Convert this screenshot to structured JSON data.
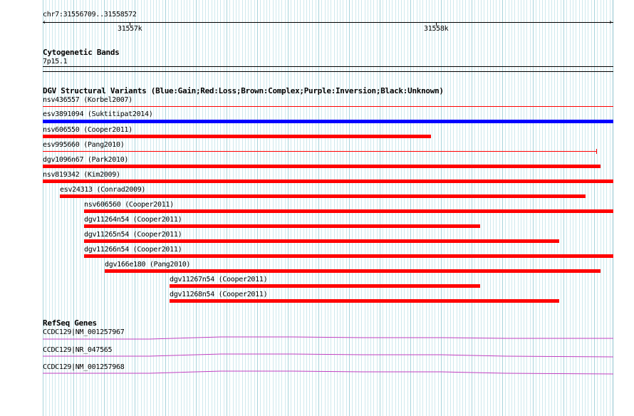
{
  "ruler": {
    "range_label": "chr7:31556709..31558572",
    "tick_labels": [
      "31557k",
      "31558k"
    ]
  },
  "cytobands": {
    "title": "Cytogenetic Bands",
    "band": "7p15.1"
  },
  "dgv": {
    "title": "DGV Structural Variants (Blue:Gain;Red:Loss;Brown:Complex;Purple:Inversion;Black:Unknown)",
    "colors": {
      "gain": "#0000ff",
      "loss": "#ff0000"
    },
    "variants": [
      {
        "label": "nsv436557 (Korbel2007)",
        "type": "loss"
      },
      {
        "label": "esv3891094 (Suktitipat2014)",
        "type": "gain"
      },
      {
        "label": "nsv606550 (Cooper2011)",
        "type": "loss"
      },
      {
        "label": "esv995660 (Pang2010)",
        "type": "loss"
      },
      {
        "label": "dgv1096n67 (Park2010)",
        "type": "loss"
      },
      {
        "label": "nsv819342 (Kim2009)",
        "type": "loss"
      },
      {
        "label": "esv24313 (Conrad2009)",
        "type": "loss"
      },
      {
        "label": "nsv606560 (Cooper2011)",
        "type": "loss"
      },
      {
        "label": "dgv11264n54 (Cooper2011)",
        "type": "loss"
      },
      {
        "label": "dgv11265n54 (Cooper2011)",
        "type": "loss"
      },
      {
        "label": "dgv11266n54 (Cooper2011)",
        "type": "loss"
      },
      {
        "label": "dgv166e180 (Pang2010)",
        "type": "loss"
      },
      {
        "label": "dgv11267n54 (Cooper2011)",
        "type": "loss"
      },
      {
        "label": "dgv11268n54 (Cooper2011)",
        "type": "loss"
      }
    ]
  },
  "refseq": {
    "title": "RefSeq Genes",
    "color": "#c040c0",
    "genes": [
      {
        "label": "CCDC129|NM_001257967"
      },
      {
        "label": "CCDC129|NR_047565"
      },
      {
        "label": "CCDC129|NM_001257968"
      }
    ]
  }
}
